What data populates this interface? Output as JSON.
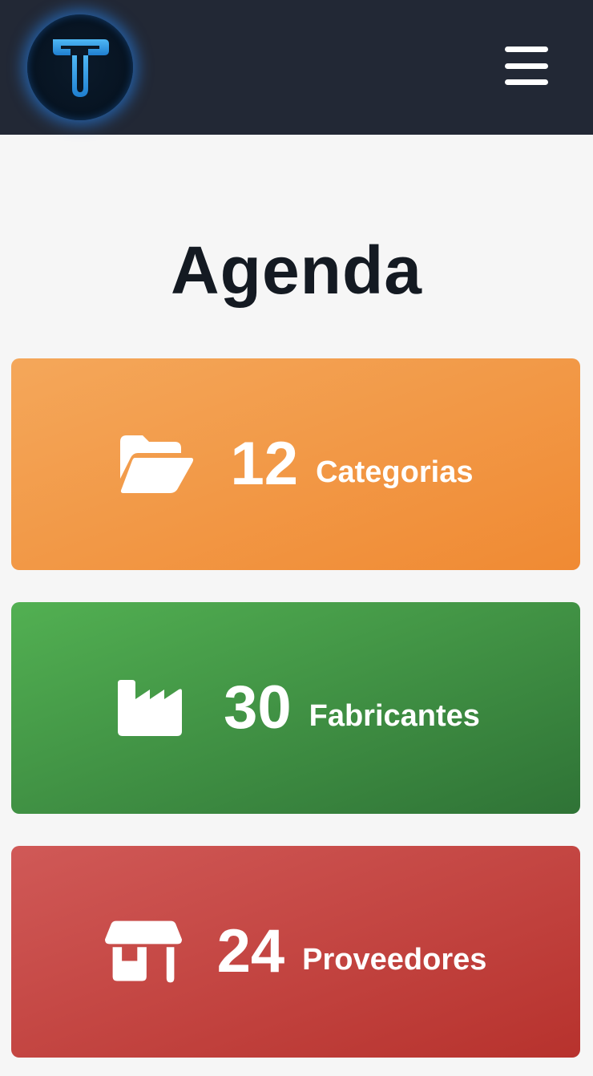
{
  "header": {
    "logo_icon": "t-logo-icon",
    "menu_icon": "hamburger-menu-icon"
  },
  "page": {
    "title": "Agenda"
  },
  "cards": [
    {
      "icon": "folder-open-icon",
      "count": "12",
      "label": "Categorias",
      "color": "#f0923c"
    },
    {
      "icon": "factory-icon",
      "count": "30",
      "label": "Fabricantes",
      "color": "#409a45"
    },
    {
      "icon": "store-icon",
      "count": "24",
      "label": "Proveedores",
      "color": "#c4423e"
    }
  ],
  "colors": {
    "header_bg": "#222835",
    "page_bg": "#f6f6f6",
    "title": "#141a22",
    "logo_accent": "#3aa6ee"
  }
}
